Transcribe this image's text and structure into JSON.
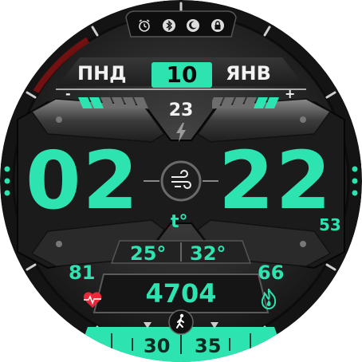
{
  "colors": {
    "accent": "#2de3b0",
    "heart": "#e8293a",
    "bezel": "#1a1a1a",
    "text": "#f2f2f2"
  },
  "status_icons": [
    "alarm-icon",
    "bluetooth-icon",
    "moon-icon",
    "lock-icon"
  ],
  "date": {
    "weekday": "ПНД",
    "day": "10",
    "month": "ЯНВ"
  },
  "battery": {
    "minus": "-",
    "plus": "+",
    "level_fraction": 0.3
  },
  "charge": {
    "value": "23"
  },
  "time": {
    "hours": "02",
    "minutes": "22",
    "seconds": "53"
  },
  "weather": {
    "label": "t°",
    "min": "25°",
    "max": "32°"
  },
  "heart_rate": {
    "value": "81"
  },
  "calories": {
    "value": "66"
  },
  "steps": {
    "value": "4704"
  },
  "dial": {
    "ticks": [
      "30",
      "35"
    ]
  }
}
